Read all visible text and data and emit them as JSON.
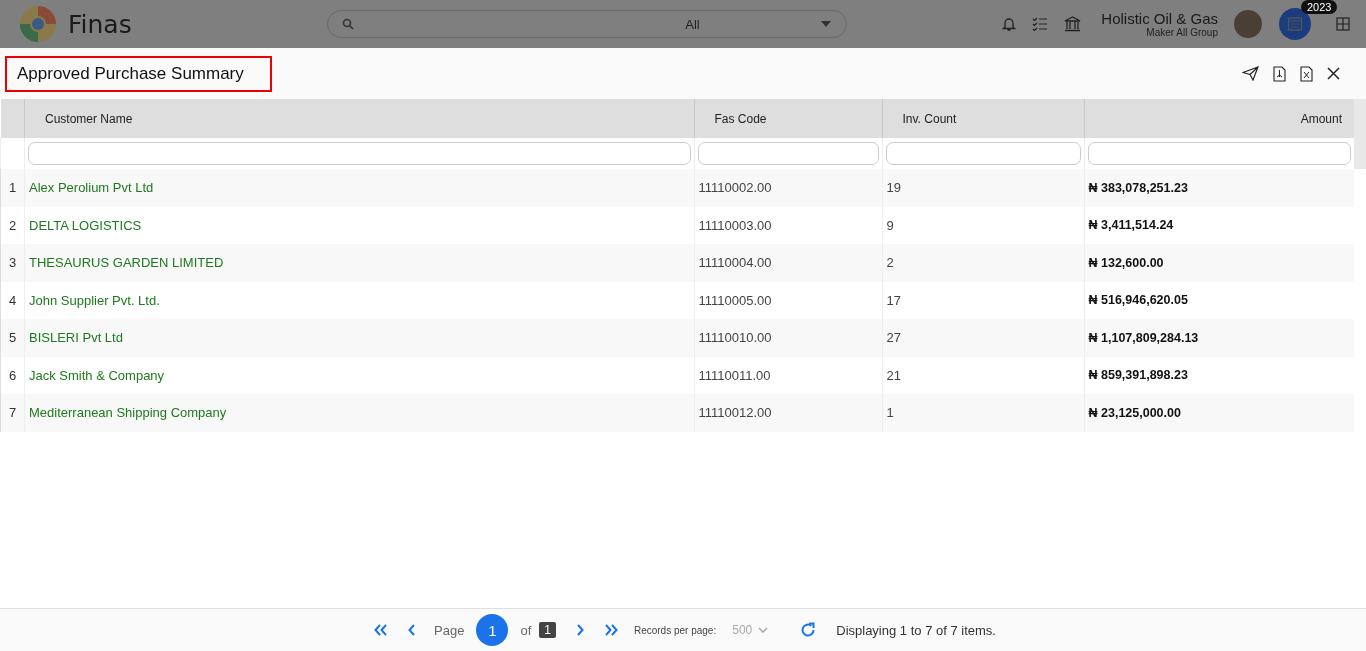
{
  "app": {
    "name": "Finas",
    "search": {
      "scope": "All"
    },
    "company": "Holistic Oil & Gas",
    "group": "Maker All Group",
    "year_badge": "2023"
  },
  "report": {
    "title": "Approved Purchase Summary"
  },
  "table": {
    "columns": [
      "Customer Name",
      "Fas Code",
      "Inv. Count",
      "Amount"
    ],
    "rows": [
      {
        "index": "1",
        "customer": "Alex Perolium Pvt Ltd",
        "fas_code": "11110002.00",
        "inv_count": "19",
        "amount": "₦ 383,078,251.23"
      },
      {
        "index": "2",
        "customer": "DELTA LOGISTICS",
        "fas_code": "11110003.00",
        "inv_count": "9",
        "amount": "₦ 3,411,514.24"
      },
      {
        "index": "3",
        "customer": "THESAURUS GARDEN LIMITED",
        "fas_code": "11110004.00",
        "inv_count": "2",
        "amount": "₦ 132,600.00"
      },
      {
        "index": "4",
        "customer": "John Supplier Pvt. Ltd.",
        "fas_code": "11110005.00",
        "inv_count": "17",
        "amount": "₦ 516,946,620.05"
      },
      {
        "index": "5",
        "customer": "BISLERI Pvt Ltd",
        "fas_code": "11110010.00",
        "inv_count": "27",
        "amount": "₦ 1,107,809,284.13"
      },
      {
        "index": "6",
        "customer": "Jack Smith & Company",
        "fas_code": "11110011.00",
        "inv_count": "21",
        "amount": "₦ 859,391,898.23"
      },
      {
        "index": "7",
        "customer": "Mediterranean Shipping Company",
        "fas_code": "11110012.00",
        "inv_count": "1",
        "amount": "₦ 23,125,000.00"
      }
    ]
  },
  "pager": {
    "page_label": "Page",
    "page": "1",
    "of_label": "of",
    "total_pages": "1",
    "records_label": "Records per page:",
    "per_page": "500",
    "summary": "Displaying 1 to 7 of 7 items."
  }
}
